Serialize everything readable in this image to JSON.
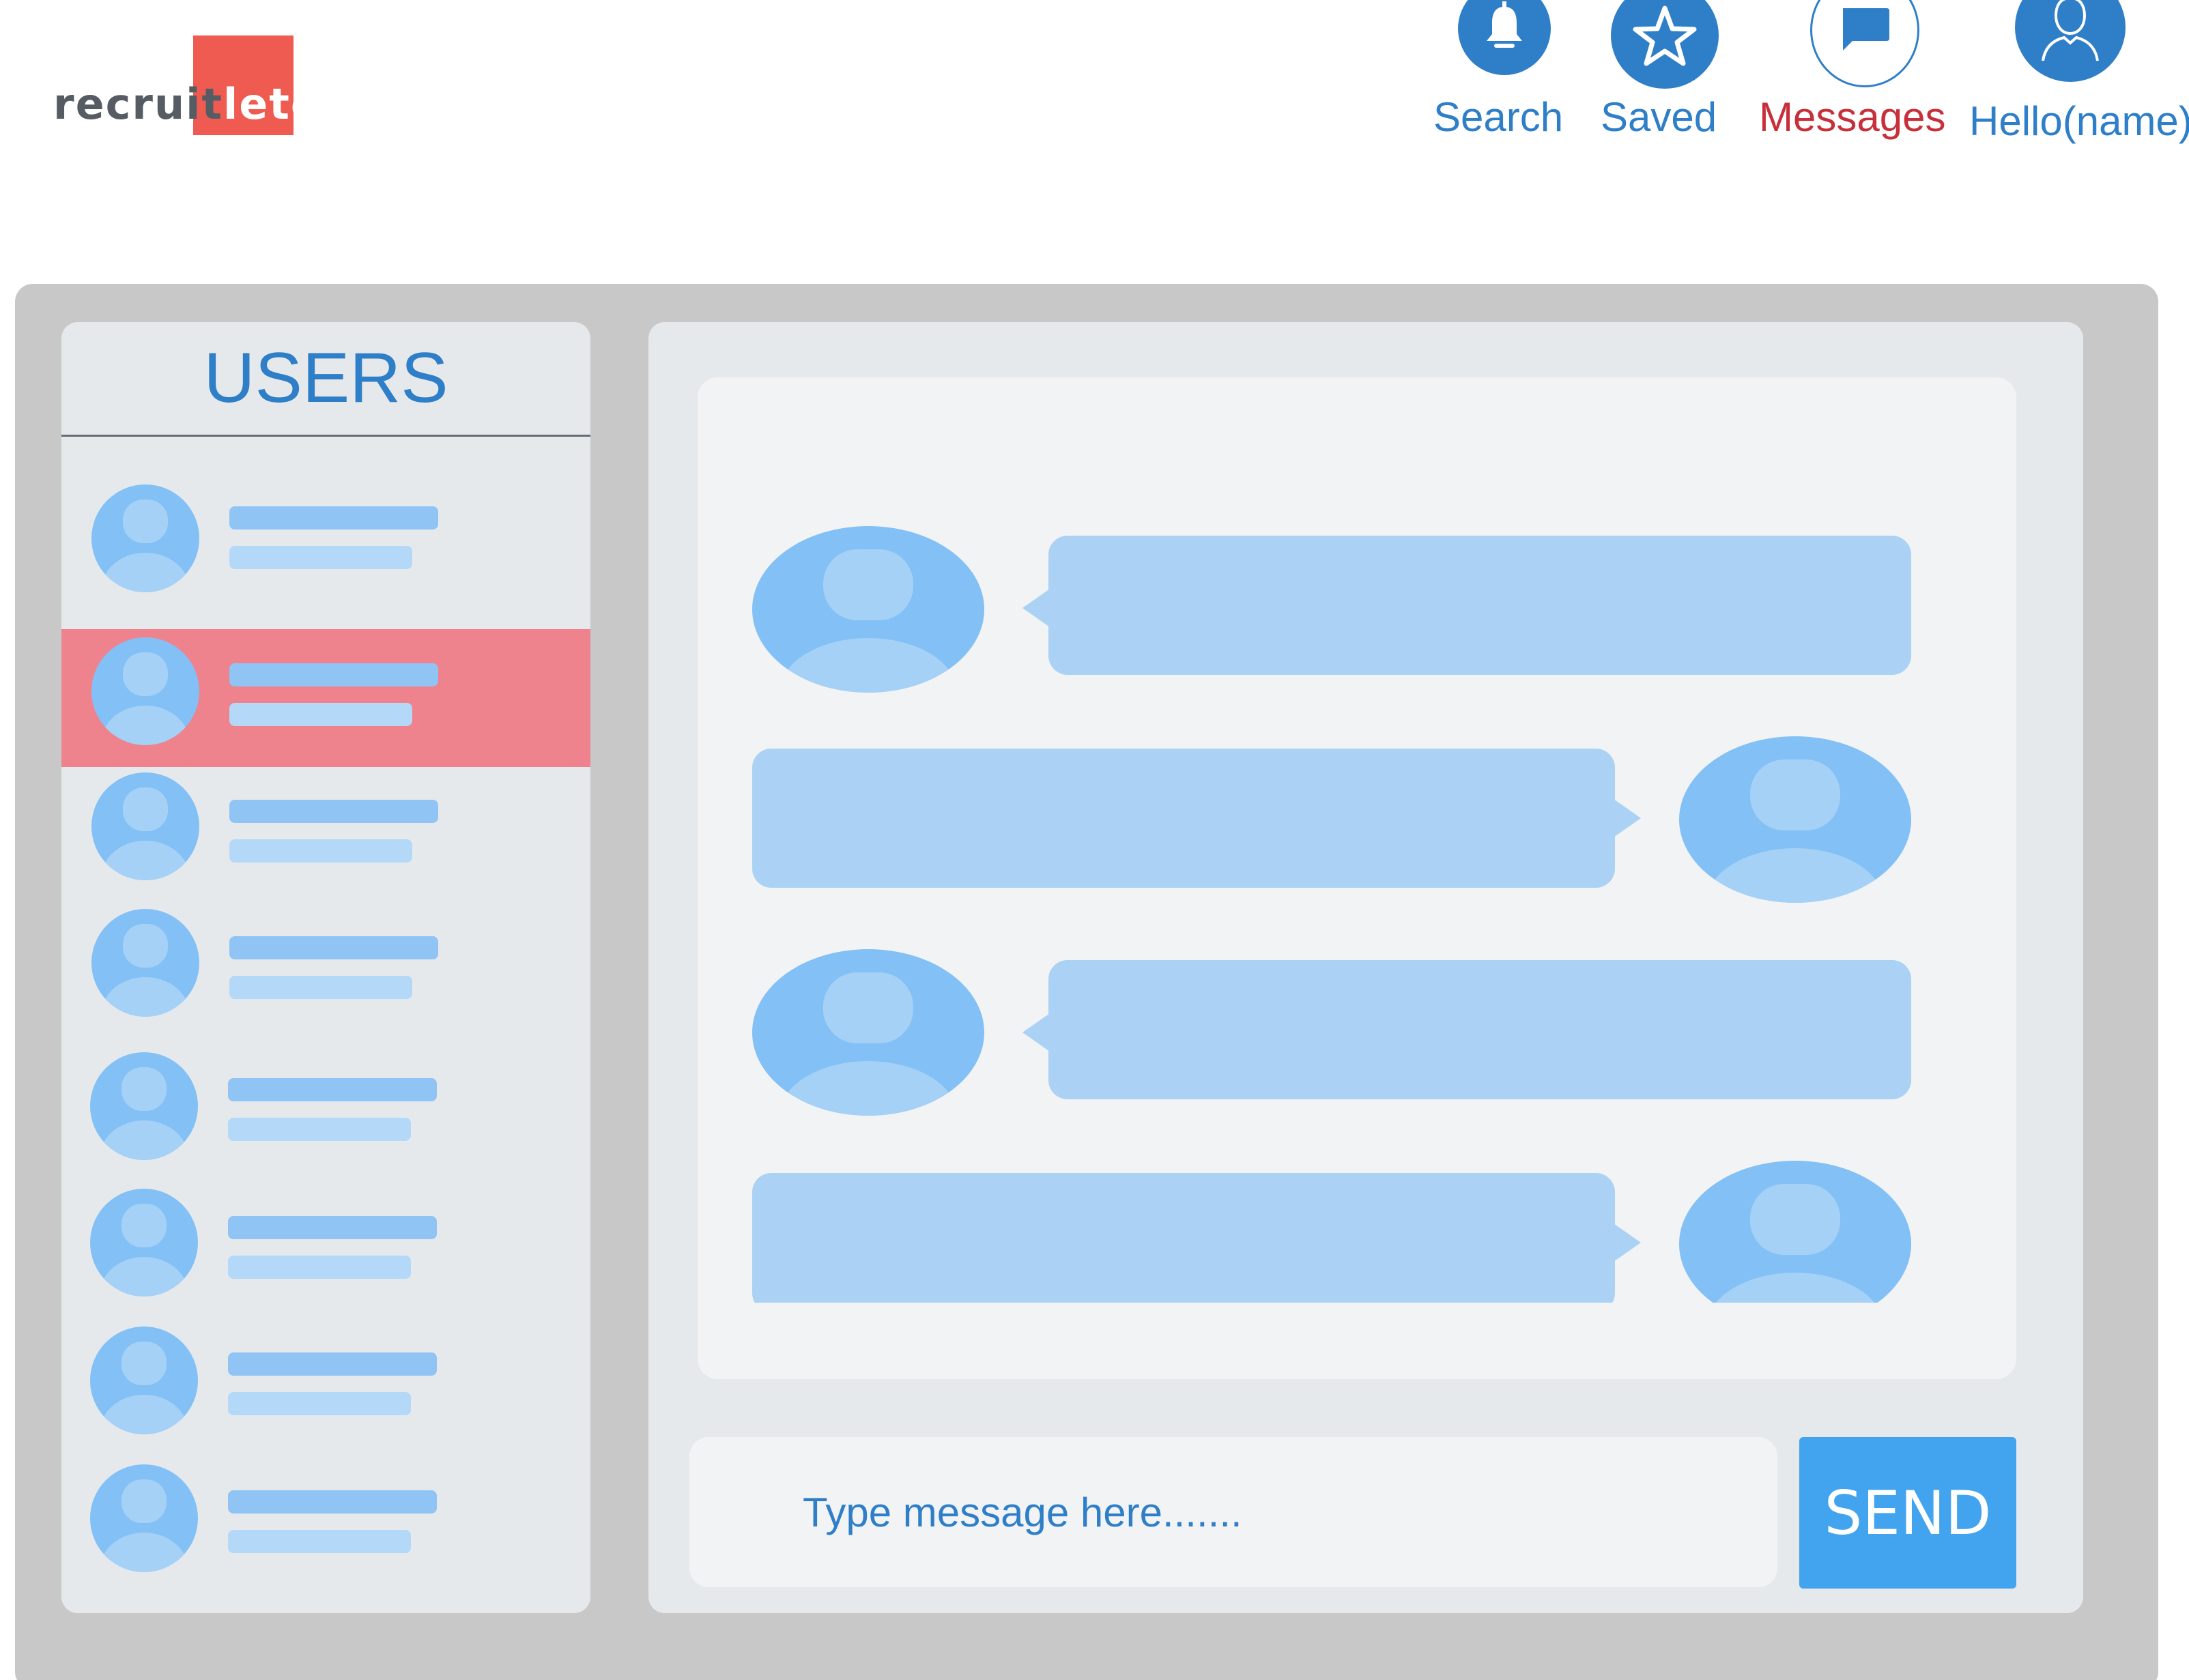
{
  "header": {
    "logo": {
      "part1": "recruit",
      "part2": "lete"
    },
    "nav": [
      {
        "label": "Search",
        "icon": "bell-icon",
        "color": "#2f7fc8",
        "icon_bg": "#2f7fc8"
      },
      {
        "label": "Saved",
        "icon": "star-icon",
        "color": "#2f7fc8",
        "icon_bg": "#2f7fc8"
      },
      {
        "label": "Messages",
        "icon": "chat-bubble-icon",
        "color": "#c7303a",
        "icon_bg": "#ffffff"
      },
      {
        "label": "Hello(name)",
        "icon": "user-icon",
        "color": "#2f7fc8",
        "icon_bg": "#2f7fc8"
      }
    ]
  },
  "users_panel": {
    "title": "USERS",
    "user_count": 8,
    "selected_index": 1
  },
  "chat": {
    "messages": [
      {
        "side": "left"
      },
      {
        "side": "right"
      },
      {
        "side": "left"
      },
      {
        "side": "right"
      }
    ]
  },
  "composer": {
    "placeholder": "Type message here.......",
    "send_label": "SEND"
  },
  "colors": {
    "accent": "#2f7fc8",
    "send_button": "#42a4ef",
    "selected_row": "#ef838d",
    "logo_red": "#ef5b50",
    "avatar": "#82c0f6",
    "bubble": "#abd2f5"
  }
}
